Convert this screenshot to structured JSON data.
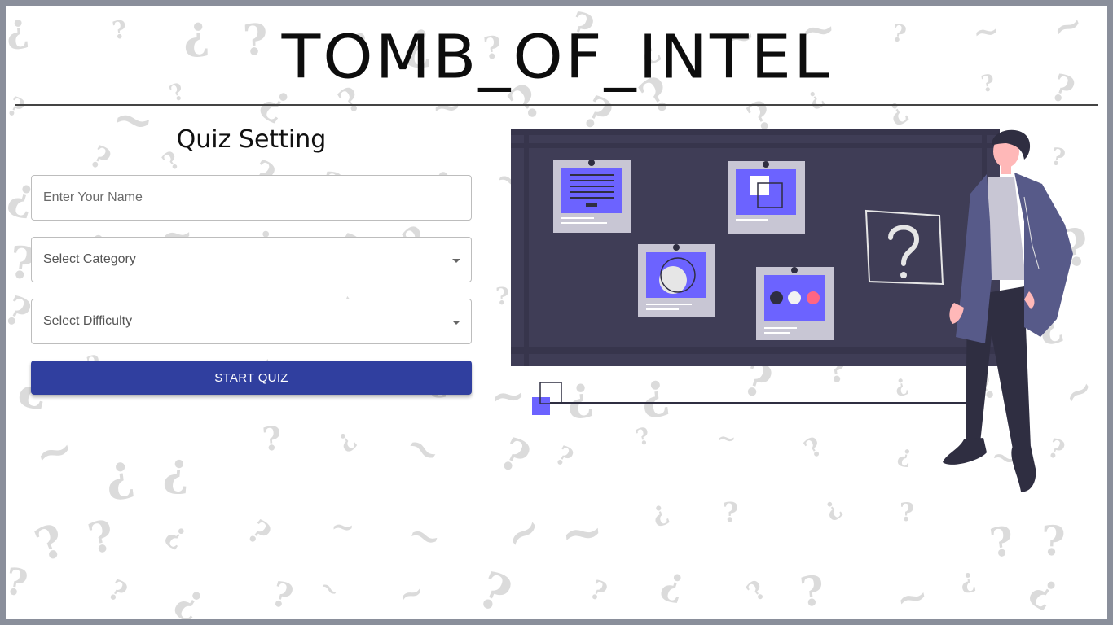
{
  "app": {
    "title": "TOMB_OF_INTEL"
  },
  "quiz_setting": {
    "heading": "Quiz Setting",
    "name_input": {
      "placeholder": "Enter Your Name",
      "value": ""
    },
    "category_select": {
      "selected": "Select Category"
    },
    "difficulty_select": {
      "selected": "Select Difficulty"
    },
    "start_button": "START QUIZ"
  },
  "colors": {
    "button": "#303f9f",
    "board": "#3f3d56",
    "accent": "#6c63ff",
    "frame": "#8a8f9b"
  },
  "icons": [
    "question-mark-pattern",
    "chevron-down-icon",
    "quiz-illustration"
  ]
}
